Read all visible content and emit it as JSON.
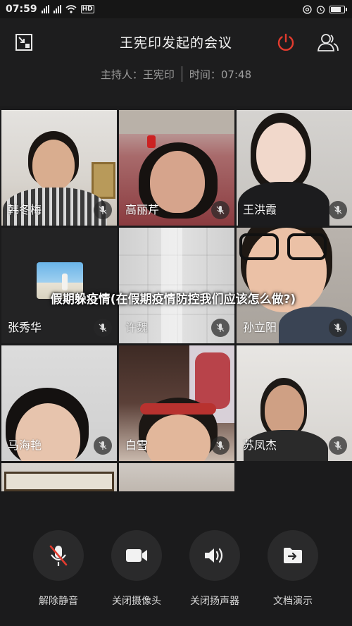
{
  "status_bar": {
    "time": "07:59",
    "network": "HD"
  },
  "header": {
    "title": "王宪印发起的会议",
    "host_label": "主持人：王宪印",
    "time_label": "时间：07:48"
  },
  "participants": [
    {
      "name": "韩冬梅"
    },
    {
      "name": "高丽芹"
    },
    {
      "name": "王洪霞"
    },
    {
      "name": "张秀华"
    },
    {
      "name": "许魏"
    },
    {
      "name": "孙立阳"
    },
    {
      "name": "马海艳"
    },
    {
      "name": "白雪"
    },
    {
      "name": "苏凤杰"
    }
  ],
  "overlay": {
    "caption": "假期躲疫情(在假期疫情防控我们应该怎么做?)"
  },
  "toolbar": {
    "unmute_label": "解除静音",
    "camera_label": "关闭摄像头",
    "speaker_label": "关闭扬声器",
    "share_label": "文档演示"
  },
  "colors": {
    "accent_red": "#e23b2e",
    "background": "#1b1b1c",
    "button_bg": "#2a2a2b"
  },
  "icons": [
    "shrink-icon",
    "power-icon",
    "participants-icon",
    "mic-muted-icon",
    "camera-icon",
    "speaker-icon",
    "document-share-icon"
  ]
}
